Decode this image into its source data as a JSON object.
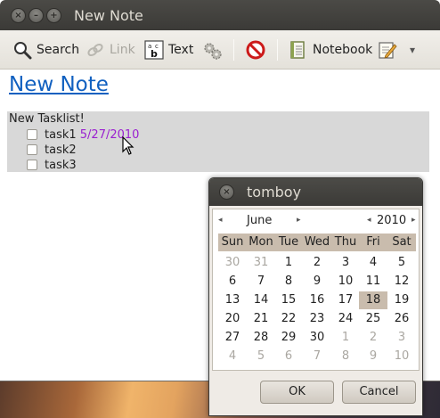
{
  "window": {
    "title": "New Note",
    "controls": [
      "×",
      "–",
      "+"
    ]
  },
  "toolbar": {
    "search_label": "Search",
    "link_label": "Link",
    "text_label": "Text",
    "notebook_label": "Notebook",
    "text_icon_glyph": "a c b",
    "menu_arrow": "▾"
  },
  "note": {
    "title": "New Note",
    "tasklist_title": "New Tasklist!",
    "tasks": [
      {
        "label": "task1",
        "checked": false,
        "due": "5/27/2010"
      },
      {
        "label": "task2",
        "checked": false,
        "due": ""
      },
      {
        "label": "task3",
        "checked": false,
        "due": ""
      }
    ]
  },
  "popup": {
    "title": "tomboy",
    "close_glyph": "×",
    "calendar": {
      "month": "June",
      "year": "2010",
      "prev_arrow": "◂",
      "next_arrow": "▸",
      "weekdays": [
        "Sun",
        "Mon",
        "Tue",
        "Wed",
        "Thu",
        "Fri",
        "Sat"
      ],
      "selected_day": "18",
      "weeks": [
        [
          "30",
          "31",
          "1",
          "2",
          "3",
          "4",
          "5"
        ],
        [
          "6",
          "7",
          "8",
          "9",
          "10",
          "11",
          "12"
        ],
        [
          "13",
          "14",
          "15",
          "16",
          "17",
          "18",
          "19"
        ],
        [
          "20",
          "21",
          "22",
          "23",
          "24",
          "25",
          "26"
        ],
        [
          "27",
          "28",
          "29",
          "30",
          "1",
          "2",
          "3"
        ],
        [
          "4",
          "5",
          "6",
          "7",
          "8",
          "9",
          "10"
        ]
      ],
      "other_month_mask": [
        [
          true,
          true,
          false,
          false,
          false,
          false,
          false
        ],
        [
          false,
          false,
          false,
          false,
          false,
          false,
          false
        ],
        [
          false,
          false,
          false,
          false,
          false,
          false,
          false
        ],
        [
          false,
          false,
          false,
          false,
          false,
          false,
          false
        ],
        [
          false,
          false,
          false,
          false,
          true,
          true,
          true
        ],
        [
          true,
          true,
          true,
          true,
          true,
          true,
          true
        ]
      ]
    },
    "ok_label": "OK",
    "cancel_label": "Cancel"
  },
  "colors": {
    "title_link": "#1060c0",
    "due_date": "#9a20d0",
    "tasklist_bg": "#d8d8d8",
    "calendar_header": "#c9bcad"
  }
}
